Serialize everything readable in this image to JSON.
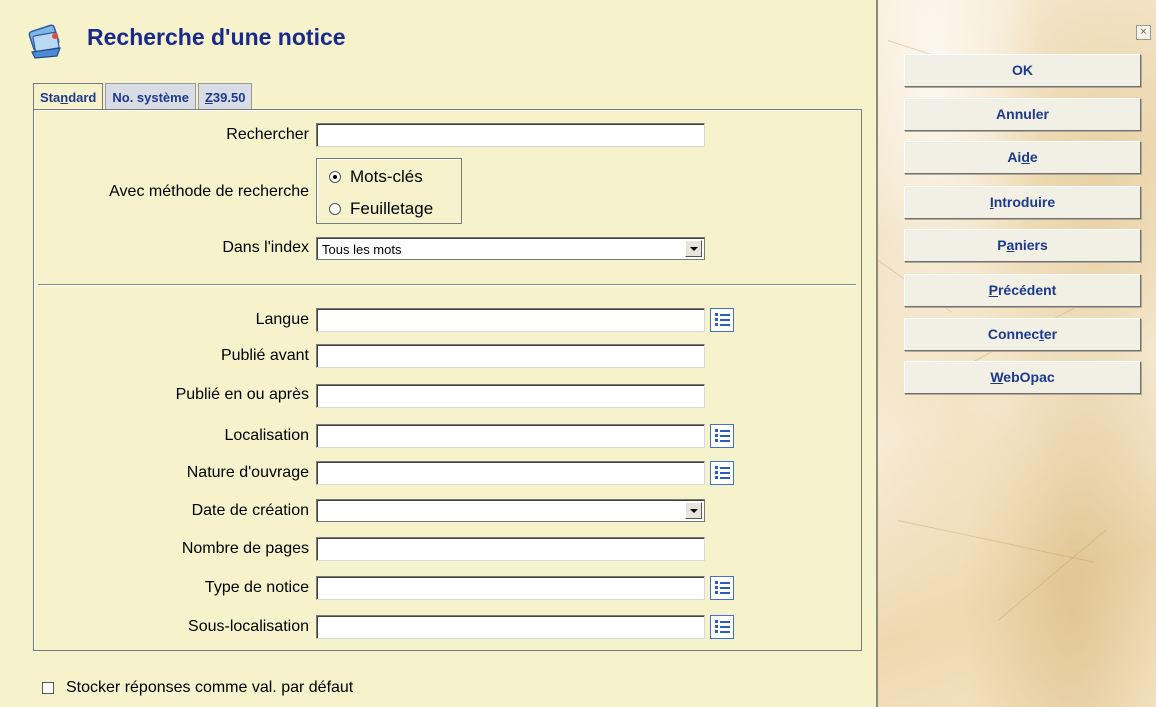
{
  "window": {
    "title": "Recherche d'une notice",
    "close_label": "×"
  },
  "tabs": [
    {
      "label": "Standard",
      "active": true
    },
    {
      "label": "No. système",
      "active": false
    },
    {
      "label": "Z39.50",
      "active": false
    }
  ],
  "form": {
    "rechercher_label": "Rechercher",
    "rechercher_value": "",
    "methode_label": "Avec méthode de recherche",
    "methode_options": [
      {
        "label": "Mots-clés",
        "checked": true
      },
      {
        "label": "Feuilletage",
        "checked": false
      }
    ],
    "index_label": "Dans l'index",
    "index_value": "Tous les mots",
    "fields": [
      {
        "label": "Langue",
        "value": "",
        "list_button": true
      },
      {
        "label": "Publié avant",
        "value": "",
        "list_button": false
      },
      {
        "label": "Publié en ou après",
        "value": "",
        "list_button": false
      },
      {
        "label": "Localisation",
        "value": "",
        "list_button": true
      },
      {
        "label": "Nature d'ouvrage",
        "value": "",
        "list_button": true
      },
      {
        "label": "Date de création",
        "value": "",
        "dropdown": true
      },
      {
        "label": "Nombre de pages",
        "value": "",
        "list_button": false
      },
      {
        "label": "Type de notice",
        "value": "",
        "list_button": true
      },
      {
        "label": "Sous-localisation",
        "value": "",
        "list_button": true
      }
    ],
    "store_defaults_label": "Stocker réponses comme val. par défaut",
    "store_defaults_checked": false
  },
  "buttons": {
    "ok": "OK",
    "annuler": "Annuler",
    "aide": "Aide",
    "introduire": "Introduire",
    "paniers": "Paniers",
    "precedent": "Précédent",
    "connecter": "Connecter",
    "webopac": "WebOpac"
  },
  "colors": {
    "title": "#1a2a8c",
    "button_text": "#1c3a8c",
    "background": "#f5f2cc"
  }
}
